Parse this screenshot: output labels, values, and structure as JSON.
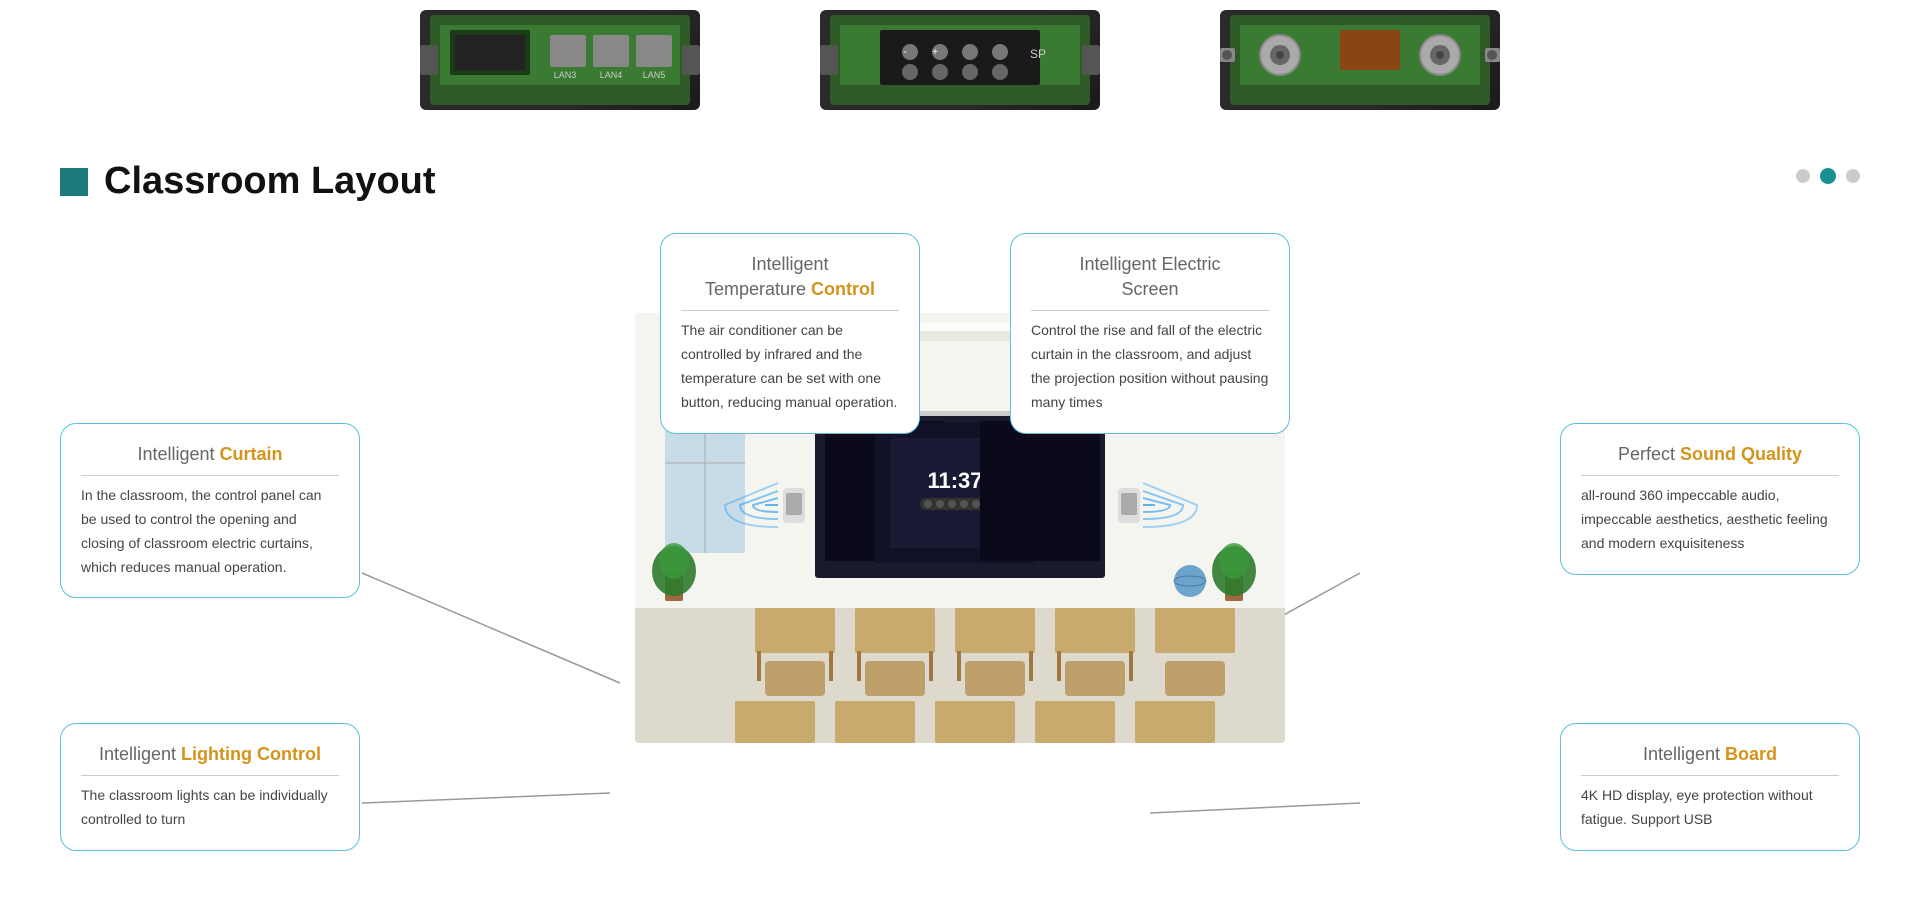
{
  "hardware": {
    "images": [
      {
        "id": "lan-card",
        "type": "lan",
        "labels": [
          "LAN3",
          "LAN4",
          "LAN5"
        ]
      },
      {
        "id": "speaker-card",
        "type": "speaker",
        "labels": [
          "SP"
        ]
      },
      {
        "id": "coax-card",
        "type": "coax",
        "labels": []
      }
    ]
  },
  "section": {
    "title": "Classroom Layout"
  },
  "nav_dots": [
    {
      "id": "dot-1",
      "active": false
    },
    {
      "id": "dot-2",
      "active": true
    },
    {
      "id": "dot-3",
      "active": false
    }
  ],
  "info_boxes": {
    "temperature": {
      "title_normal": "Intelligent",
      "title_normal2": "Temperature",
      "title_highlight": "Control",
      "text": "The air conditioner can be controlled by infrared and the temperature can be set with one button, reducing manual operation."
    },
    "screen": {
      "title_normal": "Intelligent Electric",
      "title_normal2": "Screen",
      "title_highlight": "",
      "text": "Control the rise and fall of the electric curtain in the classroom, and adjust the projection position without pausing many times"
    },
    "curtain": {
      "title_normal": "Intelligent",
      "title_highlight": "Curtain",
      "text": "In the classroom, the control panel can be used to control the opening and closing of classroom electric curtains, which reduces manual operation."
    },
    "sound": {
      "title_normal": "Perfect",
      "title_highlight": "Sound Quality",
      "text": "all-round 360 impeccable audio, impeccable aesthetics, aesthetic feeling and modern exquisiteness"
    },
    "lighting": {
      "title_normal": "Intelligent",
      "title_highlight": "Lighting Control",
      "text": "The classroom lights can be individually controlled to turn"
    },
    "board": {
      "title_normal": "Intelligent",
      "title_highlight": "Board",
      "text": "4K HD display, eye protection without fatigue. Support USB"
    }
  }
}
